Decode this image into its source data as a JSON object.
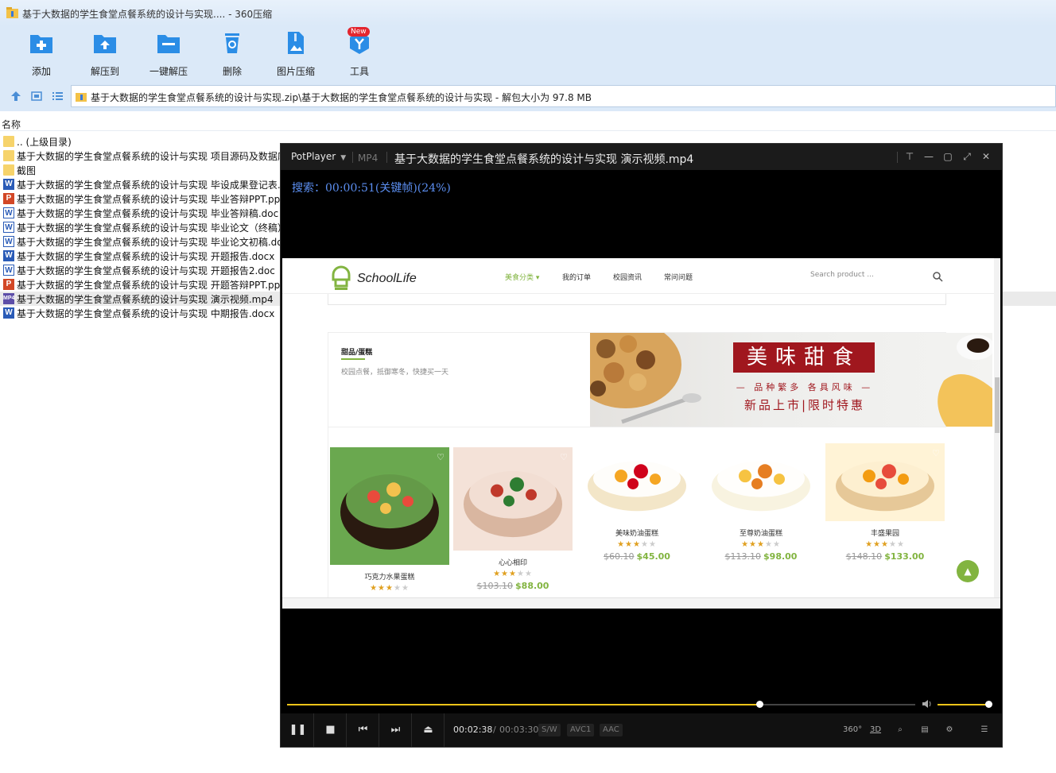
{
  "zip": {
    "title": "基于大数据的学生食堂点餐系统的设计与实现.... - 360压缩",
    "toolbar": [
      {
        "label": "添加",
        "icon": "add-icon"
      },
      {
        "label": "解压到",
        "icon": "extract-to-icon"
      },
      {
        "label": "一键解压",
        "icon": "one-click-extract-icon"
      },
      {
        "label": "删除",
        "icon": "delete-icon"
      },
      {
        "label": "图片压缩",
        "icon": "image-compress-icon"
      },
      {
        "label": "工具",
        "icon": "tools-icon",
        "badge": "New"
      }
    ],
    "address": "基于大数据的学生食堂点餐系统的设计与实现.zip\\基于大数据的学生食堂点餐系统的设计与实现 - 解包大小为 97.8 MB",
    "column_name": "名称",
    "files": [
      {
        "name": ".. (上级目录)",
        "type": "folder"
      },
      {
        "name": "基于大数据的学生食堂点餐系统的设计与实现 项目源码及数据库",
        "type": "folder"
      },
      {
        "name": "截图",
        "type": "folder"
      },
      {
        "name": "基于大数据的学生食堂点餐系统的设计与实现 毕设成果登记表.docx",
        "type": "word"
      },
      {
        "name": "基于大数据的学生食堂点餐系统的设计与实现 毕业答辩PPT.pptx",
        "type": "ppt"
      },
      {
        "name": "基于大数据的学生食堂点餐系统的设计与实现 毕业答辩稿.doc",
        "type": "word2"
      },
      {
        "name": "基于大数据的学生食堂点餐系统的设计与实现 毕业论文（终稿）.docx",
        "type": "word2"
      },
      {
        "name": "基于大数据的学生食堂点餐系统的设计与实现 毕业论文初稿.docx",
        "type": "word2"
      },
      {
        "name": "基于大数据的学生食堂点餐系统的设计与实现 开题报告.docx",
        "type": "word"
      },
      {
        "name": "基于大数据的学生食堂点餐系统的设计与实现 开题报告2.doc",
        "type": "word2"
      },
      {
        "name": "基于大数据的学生食堂点餐系统的设计与实现 开题答辩PPT.pptx",
        "type": "ppt"
      },
      {
        "name": "基于大数据的学生食堂点餐系统的设计与实现 演示视频.mp4",
        "type": "video",
        "selected": true
      },
      {
        "name": "基于大数据的学生食堂点餐系统的设计与实现 中期报告.docx",
        "type": "word"
      }
    ]
  },
  "player": {
    "menu": "PotPlayer",
    "format": "MP4",
    "title": "基于大数据的学生食堂点餐系统的设计与实现 演示视频.mp4",
    "osd": "搜索：00:00:51(关键帧)(24%)",
    "time_current": "00:02:38",
    "time_sep": "/",
    "time_total": "00:03:30",
    "codecs": [
      "S/W",
      "AVC1",
      "AAC"
    ],
    "progress": 0.752,
    "volume": 1.0,
    "right_buttons": [
      "360°",
      "3D"
    ]
  },
  "site": {
    "logo": "SchoolLife",
    "nav": [
      "美食分类",
      "我的订单",
      "校园资讯",
      "常问问题"
    ],
    "search_placeholder": "Search product ...",
    "category_title": "甜品/蛋糕",
    "category_desc": "校园点餐，抵御寒冬，快捷买一天",
    "banner_title": "美味甜食",
    "banner_sub1": "— 品种繁多 各具风味 —",
    "banner_sub2": "新品上市|限时特惠",
    "products": [
      {
        "name": "巧克力水果蛋糕",
        "rating": 3,
        "old_price": "",
        "price": ""
      },
      {
        "name": "心心相印",
        "rating": 3,
        "old_price": "$103.10",
        "price": "$88.00"
      },
      {
        "name": "美味奶油蛋糕",
        "rating": 3,
        "old_price": "$60.10",
        "price": "$45.00"
      },
      {
        "name": "至尊奶油蛋糕",
        "rating": 3,
        "old_price": "$113.10",
        "price": "$98.00"
      },
      {
        "name": "丰盛果园",
        "rating": 3,
        "old_price": "$148.10",
        "price": "$133.00"
      }
    ]
  },
  "colors": {
    "accent_green": "#82b440",
    "seek_yellow": "#f0c419",
    "osd_blue": "#5b8ef0",
    "banner_red": "#a0171e"
  }
}
